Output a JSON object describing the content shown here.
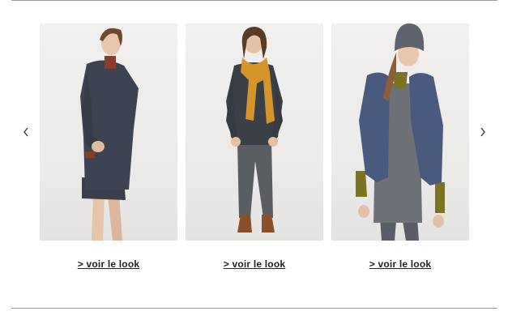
{
  "carousel": {
    "prev_icon": "chevron-left-icon",
    "next_icon": "chevron-right-icon",
    "looks": [
      {
        "link_label": "> voir le look"
      },
      {
        "link_label": "> voir le look"
      },
      {
        "link_label": "> voir le look"
      }
    ]
  },
  "colors": {
    "rule": "#9a9a9a",
    "link": "#222222",
    "photo_bg": "#eeedeb"
  }
}
